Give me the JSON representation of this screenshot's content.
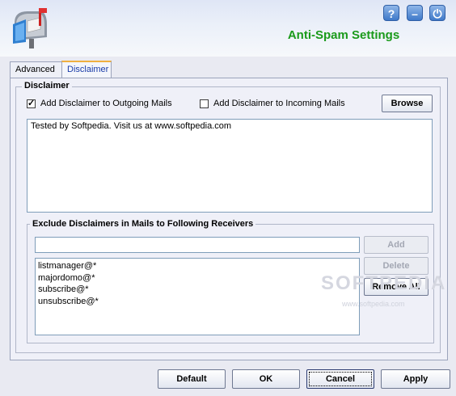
{
  "header": {
    "title": "Anti-Spam Settings",
    "help_label": "?",
    "minimize_label": "–",
    "power_label": "⏻"
  },
  "tabs": [
    {
      "label": "Advanced",
      "active": false
    },
    {
      "label": "Disclaimer",
      "active": true
    }
  ],
  "disclaimer": {
    "group_title": "Disclaimer",
    "outgoing_label": "Add Disclaimer to Outgoing Mails",
    "outgoing_checked": true,
    "incoming_label": "Add Disclaimer to Incoming Mails",
    "incoming_checked": false,
    "browse_label": "Browse",
    "text": "Tested by Softpedia. Visit us at www.softpedia.com"
  },
  "exclude": {
    "group_title": "Exclude Disclaimers in Mails to Following Receivers",
    "input_value": "",
    "add_label": "Add",
    "delete_label": "Delete",
    "remove_all_label": "Remove All",
    "receivers": [
      "listmanager@*",
      "majordomo@*",
      "subscribe@*",
      "unsubscribe@*"
    ]
  },
  "watermark": {
    "main": "SOFTPEDIA",
    "sub": "www.softpedia.com"
  },
  "footer": {
    "default_label": "Default",
    "ok_label": "OK",
    "cancel_label": "Cancel",
    "apply_label": "Apply"
  },
  "colors": {
    "title": "#1a9a1a",
    "accent_blue": "#3f79c9",
    "tab_active_text": "#1a3ca8"
  }
}
